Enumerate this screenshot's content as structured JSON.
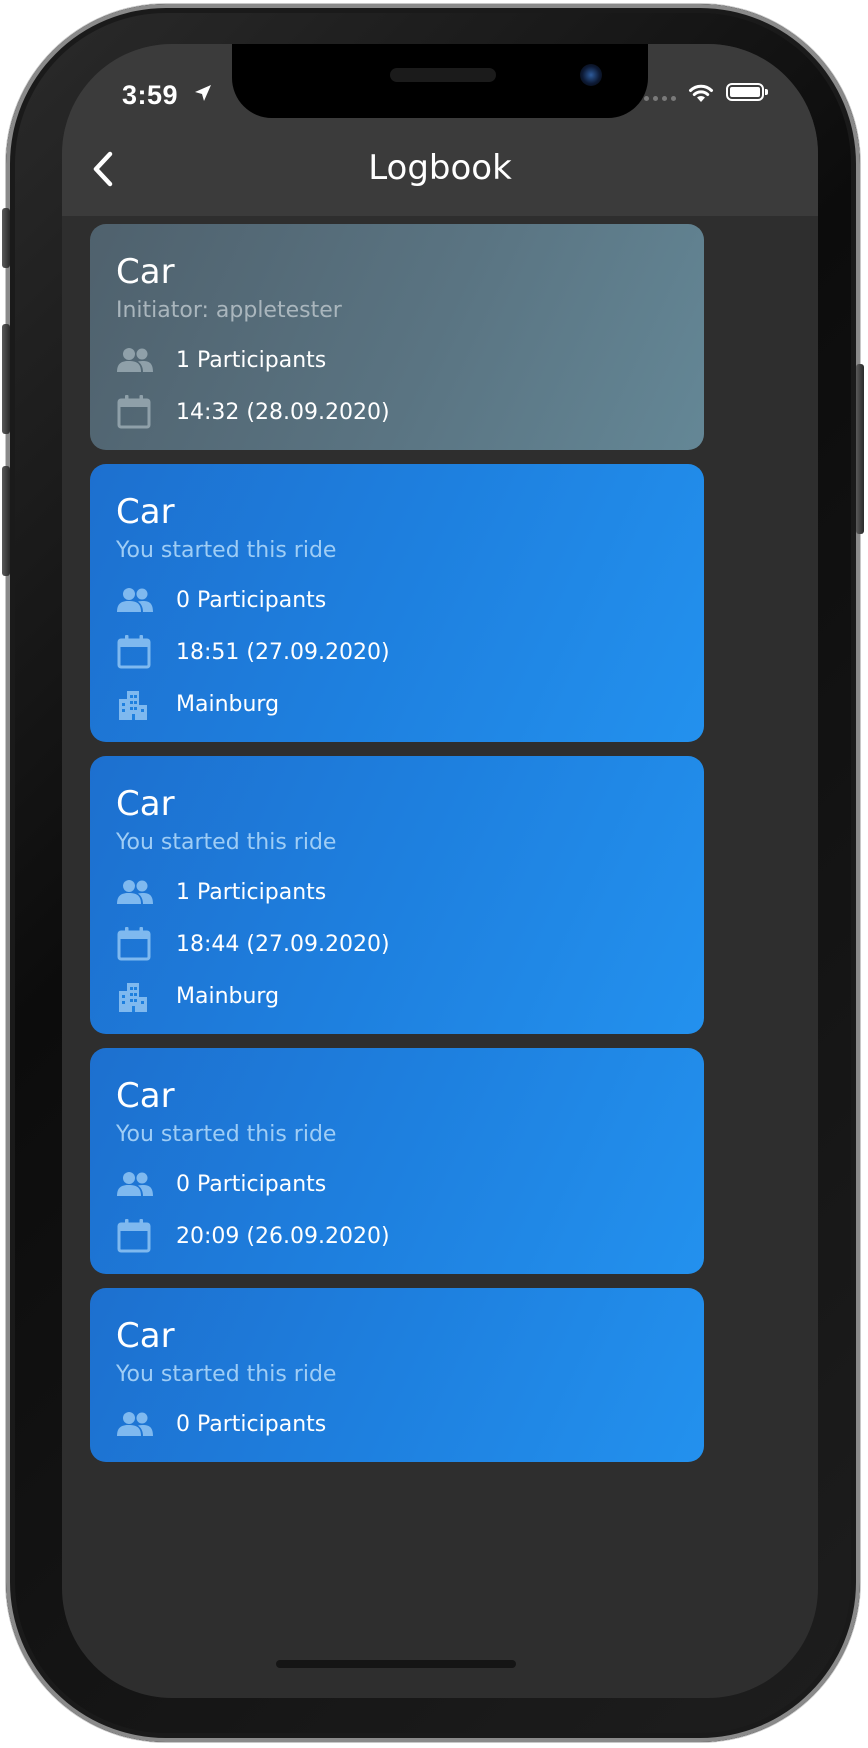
{
  "status_bar": {
    "time": "3:59"
  },
  "header": {
    "title": "Logbook",
    "back_icon": "chevron-left-icon"
  },
  "colors": {
    "navbar": "#3b3b3b",
    "background": "#2e2e2e",
    "card_gray": "#5a7482",
    "card_blue": "#1e80df",
    "icon_gray": "#8fa0a9",
    "icon_blue": "#7fb9ef"
  },
  "rides": [
    {
      "style": "gray",
      "vehicle": "Car",
      "subtitle": "Initiator: appletester",
      "participants": "1 Participants",
      "datetime": "14:32 (28.09.2020)",
      "location": null
    },
    {
      "style": "blue",
      "vehicle": "Car",
      "subtitle": "You started this ride",
      "participants": "0 Participants",
      "datetime": "18:51 (27.09.2020)",
      "location": "Mainburg"
    },
    {
      "style": "blue",
      "vehicle": "Car",
      "subtitle": "You started this ride",
      "participants": "1 Participants",
      "datetime": "18:44 (27.09.2020)",
      "location": "Mainburg"
    },
    {
      "style": "blue",
      "vehicle": "Car",
      "subtitle": "You started this ride",
      "participants": "0 Participants",
      "datetime": "20:09 (26.09.2020)",
      "location": null
    },
    {
      "style": "blue",
      "vehicle": "Car",
      "subtitle": "You started this ride",
      "participants": "0 Participants",
      "datetime": null,
      "location": null
    }
  ],
  "icons": {
    "participants": "people-icon",
    "datetime": "calendar-icon",
    "location": "city-icon"
  }
}
